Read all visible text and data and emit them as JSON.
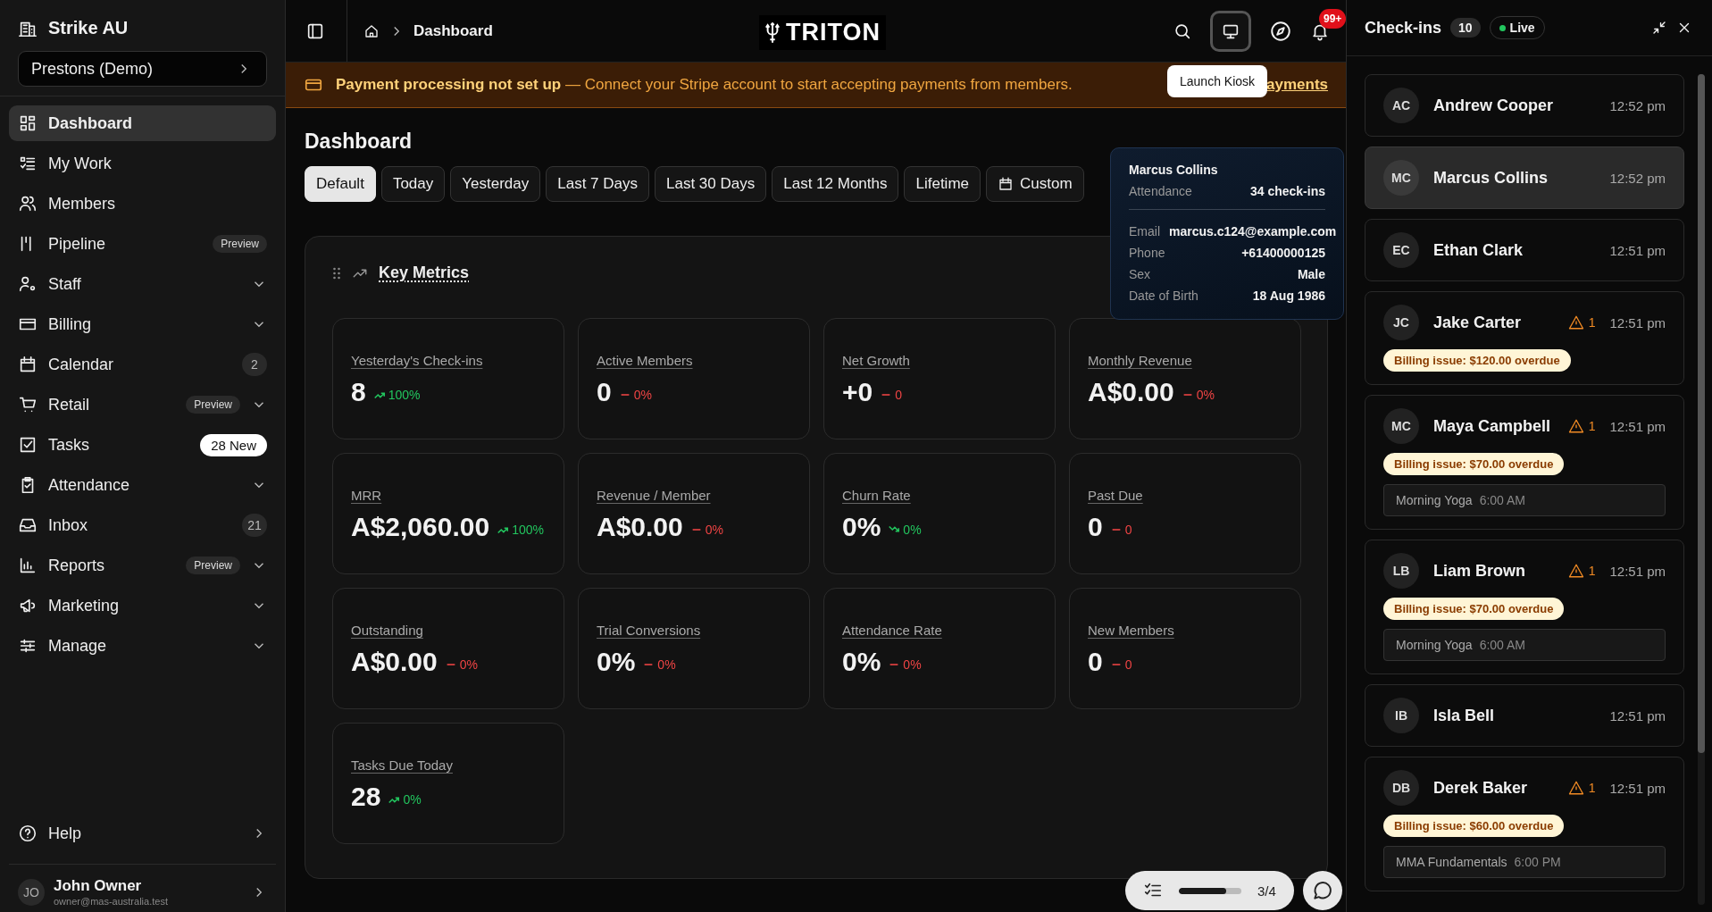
{
  "sidebar": {
    "brand": "Strike AU",
    "location": "Prestons (Demo)",
    "items": [
      {
        "label": "Dashboard",
        "selected": true
      },
      {
        "label": "My Work",
        "selected": false
      },
      {
        "label": "Members",
        "selected": false
      },
      {
        "label": "Pipeline",
        "selected": false,
        "badge": {
          "kind": "preview",
          "text": "Preview"
        }
      },
      {
        "label": "Staff",
        "selected": false,
        "expandable": true
      },
      {
        "label": "Billing",
        "selected": false,
        "expandable": true
      },
      {
        "label": "Calendar",
        "selected": false,
        "badge": {
          "kind": "count",
          "text": "2"
        }
      },
      {
        "label": "Retail",
        "selected": false,
        "expandable": true,
        "badge": {
          "kind": "preview",
          "text": "Preview"
        }
      },
      {
        "label": "Tasks",
        "selected": false,
        "badge": {
          "kind": "new",
          "text": "28 New"
        }
      },
      {
        "label": "Attendance",
        "selected": false,
        "expandable": true
      },
      {
        "label": "Inbox",
        "selected": false,
        "badge": {
          "kind": "count",
          "text": "21"
        }
      },
      {
        "label": "Reports",
        "selected": false,
        "expandable": true,
        "badge": {
          "kind": "preview",
          "text": "Preview"
        }
      },
      {
        "label": "Marketing",
        "selected": false,
        "expandable": true
      },
      {
        "label": "Manage",
        "selected": false,
        "expandable": true
      }
    ],
    "help": "Help",
    "user": {
      "initials": "JO",
      "name": "John Owner",
      "email": "owner@mas-australia.test"
    }
  },
  "header": {
    "breadcrumb": "Dashboard",
    "logo": "TRITON",
    "notifications": "99+",
    "tooltip": "Launch Kiosk"
  },
  "banner": {
    "message": "**Payment processing not set up** — Connect your Stripe account to start accepting payments from members.",
    "link": "ayments"
  },
  "page_title": "Dashboard",
  "ranges": [
    {
      "label": "Default",
      "selected": true
    },
    {
      "label": "Today",
      "selected": false
    },
    {
      "label": "Yesterday",
      "selected": false
    },
    {
      "label": "Last 7 Days",
      "selected": false
    },
    {
      "label": "Last 30 Days",
      "selected": false
    },
    {
      "label": "Last 12 Months",
      "selected": false
    },
    {
      "label": "Lifetime",
      "selected": false
    },
    {
      "label": "Custom",
      "selected": false,
      "kind": "calendar"
    }
  ],
  "key_metrics": {
    "title": "Key Metrics",
    "metrics": [
      {
        "label": "Yesterday's Check-ins",
        "value": "8",
        "change": "100%",
        "kind": "up",
        "positive": true
      },
      {
        "label": "Active Members",
        "value": "0",
        "change": "0%",
        "kind": "flat",
        "positive": false
      },
      {
        "label": "Net Growth",
        "value": "+0",
        "change": "0",
        "kind": "flat",
        "positive": false
      },
      {
        "label": "Monthly Revenue",
        "value": "A$0.00",
        "change": "0%",
        "kind": "flat",
        "positive": false
      },
      {
        "label": "MRR",
        "value": "A$2,060.00",
        "change": "100%",
        "kind": "up",
        "positive": true
      },
      {
        "label": "Revenue / Member",
        "value": "A$0.00",
        "change": "0%",
        "kind": "flat",
        "positive": false
      },
      {
        "label": "Churn Rate",
        "value": "0%",
        "change": "0%",
        "kind": "down",
        "positive": true
      },
      {
        "label": "Past Due",
        "value": "0",
        "change": "0",
        "kind": "flat",
        "positive": false
      },
      {
        "label": "Outstanding",
        "value": "A$0.00",
        "change": "0%",
        "kind": "flat",
        "positive": false
      },
      {
        "label": "Trial Conversions",
        "value": "0%",
        "change": "0%",
        "kind": "flat",
        "positive": false
      },
      {
        "label": "Attendance Rate",
        "value": "0%",
        "change": "0%",
        "kind": "flat",
        "positive": false
      },
      {
        "label": "New Members",
        "value": "0",
        "change": "0",
        "kind": "flat",
        "positive": false
      },
      {
        "label": "Tasks Due Today",
        "value": "28",
        "change": "0%",
        "kind": "up",
        "positive": true
      }
    ]
  },
  "hover_card": {
    "name": "Marcus Collins",
    "attendance_label": "Attendance",
    "attendance": "34 check-ins",
    "fields": [
      {
        "label": "Email",
        "value": "marcus.c124@example.com"
      },
      {
        "label": "Phone",
        "value": "+61400000125"
      },
      {
        "label": "Sex",
        "value": "Male"
      },
      {
        "label": "Date of Birth",
        "value": "18 Aug 1986"
      }
    ]
  },
  "checklist": {
    "level": 0.75,
    "progress": "3/4"
  },
  "checkins": {
    "title": "Check-ins",
    "count": "10",
    "live": "Live",
    "items": [
      {
        "initials": "AC",
        "name": "Andrew Cooper",
        "time": "12:52 pm",
        "selected": false
      },
      {
        "initials": "MC",
        "name": "Marcus Collins",
        "time": "12:52 pm",
        "selected": true
      },
      {
        "initials": "EC",
        "name": "Ethan Clark",
        "time": "12:51 pm",
        "selected": false
      },
      {
        "initials": "JC",
        "name": "Jake Carter",
        "time": "12:51 pm",
        "selected": false,
        "alerts": "1",
        "billing": "Billing issue: $120.00 overdue"
      },
      {
        "initials": "MC",
        "name": "Maya Campbell",
        "time": "12:51 pm",
        "selected": false,
        "alerts": "1",
        "billing": "Billing issue: $70.00 overdue",
        "class": {
          "name": "Morning Yoga",
          "time": "6:00 AM"
        }
      },
      {
        "initials": "LB",
        "name": "Liam Brown",
        "time": "12:51 pm",
        "selected": false,
        "alerts": "1",
        "billing": "Billing issue: $70.00 overdue",
        "class": {
          "name": "Morning Yoga",
          "time": "6:00 AM"
        }
      },
      {
        "initials": "IB",
        "name": "Isla Bell",
        "time": "12:51 pm",
        "selected": false
      },
      {
        "initials": "DB",
        "name": "Derek Baker",
        "time": "12:51 pm",
        "selected": false,
        "alerts": "1",
        "billing": "Billing issue: $60.00 overdue",
        "class": {
          "name": "MMA Fundamentals",
          "time": "6:00 PM"
        }
      }
    ]
  }
}
